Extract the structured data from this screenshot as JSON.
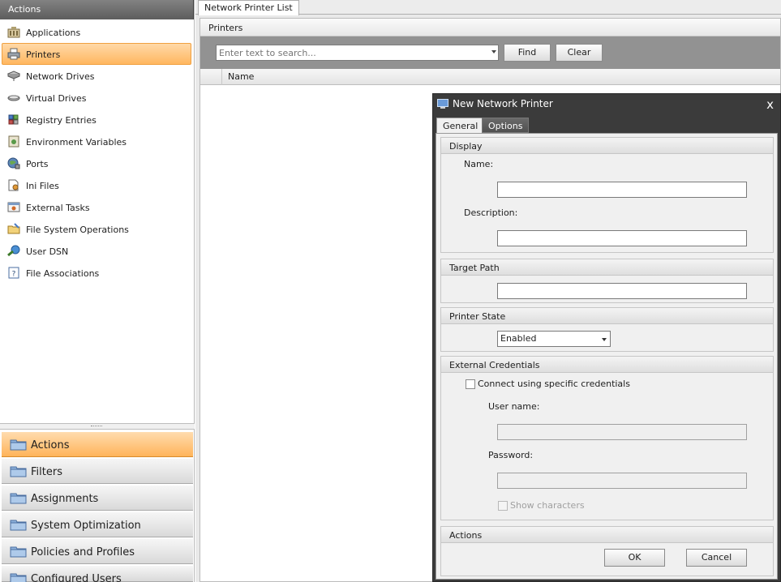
{
  "left_panel": {
    "header": "Actions",
    "items": [
      {
        "label": "Applications",
        "icon": "applications-icon"
      },
      {
        "label": "Printers",
        "icon": "printer-icon",
        "selected": true
      },
      {
        "label": "Network Drives",
        "icon": "network-drive-icon"
      },
      {
        "label": "Virtual Drives",
        "icon": "virtual-drive-icon"
      },
      {
        "label": "Registry Entries",
        "icon": "registry-icon"
      },
      {
        "label": "Environment Variables",
        "icon": "environment-variables-icon"
      },
      {
        "label": "Ports",
        "icon": "ports-icon"
      },
      {
        "label": "Ini Files",
        "icon": "ini-file-icon"
      },
      {
        "label": "External Tasks",
        "icon": "external-tasks-icon"
      },
      {
        "label": "File System Operations",
        "icon": "file-system-icon"
      },
      {
        "label": "User DSN",
        "icon": "user-dsn-icon"
      },
      {
        "label": "File Associations",
        "icon": "file-associations-icon"
      }
    ],
    "categories": [
      {
        "label": "Actions",
        "active": true
      },
      {
        "label": "Filters"
      },
      {
        "label": "Assignments"
      },
      {
        "label": "System Optimization"
      },
      {
        "label": "Policies and Profiles"
      },
      {
        "label": "Configured Users"
      }
    ]
  },
  "main": {
    "tab_label": "Network Printer List",
    "section_header": "Printers",
    "search": {
      "placeholder": "Enter text to search...",
      "find_label": "Find",
      "clear_label": "Clear"
    },
    "grid": {
      "column_name": "Name"
    }
  },
  "dialog": {
    "title": "New Network Printer",
    "close_glyph": "x",
    "tabs": {
      "general": "General",
      "options": "Options"
    },
    "display": {
      "header": "Display",
      "name_label": "Name:",
      "description_label": "Description:"
    },
    "target_path": {
      "header": "Target Path"
    },
    "printer_state": {
      "header": "Printer State",
      "value": "Enabled"
    },
    "external_credentials": {
      "header": "External Credentials",
      "connect_label": "Connect using specific credentials",
      "username_label": "User name:",
      "password_label": "Password:",
      "show_characters_label": "Show characters"
    },
    "actions": {
      "header": "Actions",
      "ok_label": "OK",
      "cancel_label": "Cancel"
    }
  },
  "colors": {
    "selection_orange": "#ffb760",
    "header_gray": "#5d5d5d",
    "dialog_dark": "#3b3b3b"
  }
}
